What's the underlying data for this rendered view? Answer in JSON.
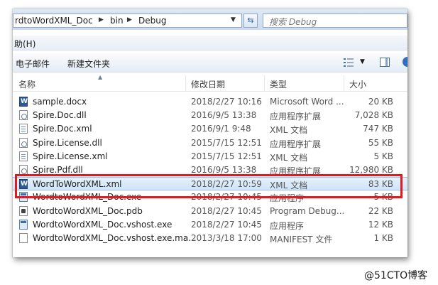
{
  "address": {
    "crumbs": [
      "rdtoWordXML_Doc",
      "bin",
      "Debug"
    ]
  },
  "search": {
    "placeholder": "搜索 Debug"
  },
  "menu": {
    "help": "助(H)"
  },
  "toolbar": {
    "email": "电子邮件",
    "new_folder": "新建文件夹"
  },
  "columns": {
    "name": "名称",
    "date": "修改日期",
    "type": "类型",
    "size": "大小"
  },
  "files": [
    {
      "name": "sample.docx",
      "date": "2018/2/27 10:16",
      "type": "Microsoft Word ...",
      "size": "20 KB",
      "icon": "word-doc-icon"
    },
    {
      "name": "Spire.Doc.dll",
      "date": "2016/9/5 13:38",
      "type": "应用程序扩展",
      "size": "7,028 KB",
      "icon": "dll-icon"
    },
    {
      "name": "Spire.Doc.xml",
      "date": "2016/9/1 9:48",
      "type": "XML 文档",
      "size": "747 KB",
      "icon": "xml-icon"
    },
    {
      "name": "Spire.License.dll",
      "date": "2015/7/15 12:51",
      "type": "应用程序扩展",
      "size": "55 KB",
      "icon": "dll-icon"
    },
    {
      "name": "Spire.License.xml",
      "date": "2015/7/15 12:51",
      "type": "XML 文档",
      "size": "5 KB",
      "icon": "xml-icon"
    },
    {
      "name": "Spire.Pdf.dll",
      "date": "2016/9/5 13:38",
      "type": "应用程序扩展",
      "size": "12,980 KB",
      "icon": "dll-icon"
    },
    {
      "name": "WordToWordXML.xml",
      "date": "2018/2/27 10:59",
      "type": "XML 文档",
      "size": "83 KB",
      "icon": "word-xml-icon",
      "selected": true
    },
    {
      "name": "WordtoWordXML_Doc.exe",
      "date": "2018/2/27 10:45",
      "type": "应用程序",
      "size": "5 KB",
      "icon": "exe-icon"
    },
    {
      "name": "WordtoWordXML_Doc.pdb",
      "date": "2018/2/27 10:45",
      "type": "Program Debug...",
      "size": "22 KB",
      "icon": "pdb-icon"
    },
    {
      "name": "WordtoWordXML_Doc.vshost.exe",
      "date": "2018/2/27 10:45",
      "type": "应用程序",
      "size": "12 KB",
      "icon": "exe-icon"
    },
    {
      "name": "WordtoWordXML_Doc.vshost.exe.ma...",
      "date": "2013/3/18 17:00",
      "type": "MANIFEST 文件",
      "size": "1 KB",
      "icon": "manifest-icon"
    }
  ],
  "watermark": "@51CTO博客"
}
